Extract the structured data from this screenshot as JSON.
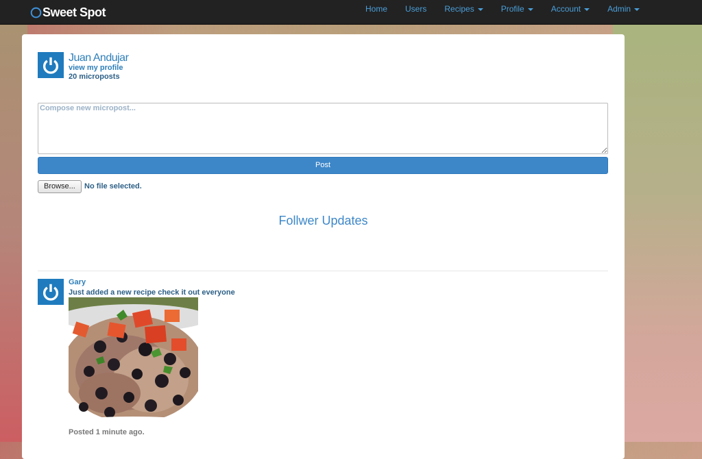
{
  "navbar": {
    "brand": "Sweet Spot",
    "items": [
      {
        "label": "Home",
        "dropdown": false
      },
      {
        "label": "Users",
        "dropdown": false
      },
      {
        "label": "Recipes",
        "dropdown": true
      },
      {
        "label": "Profile",
        "dropdown": true
      },
      {
        "label": "Account",
        "dropdown": true
      },
      {
        "label": "Admin",
        "dropdown": true
      }
    ]
  },
  "user": {
    "name": "Juan Andujar",
    "profile_link": "view my profile",
    "micropost_count": "20 microposts",
    "avatar_icon": "power-icon"
  },
  "composer": {
    "placeholder": "Compose new micropost...",
    "value": "",
    "post_label": "Post",
    "browse_label": "Browse...",
    "file_status": "No file selected."
  },
  "feed": {
    "title": "Follwer Updates",
    "items": [
      {
        "author": "Gary",
        "content": "Just added a new recipe check it out everyone",
        "image": "rice-and-beans-dish",
        "timestamp": "Posted 1 minute ago."
      }
    ]
  },
  "colors": {
    "navbar_bg": "#222222",
    "nav_link": "#4a9fd9",
    "accent": "#3d87c9",
    "avatar_bg": "#1f7bbd"
  }
}
